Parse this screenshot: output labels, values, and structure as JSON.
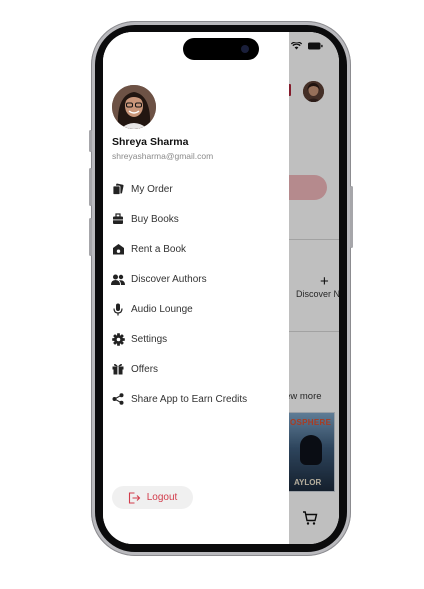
{
  "user": {
    "name": "Shreya Sharma",
    "email": "shreyasharma@gmail.com"
  },
  "menu": {
    "items": [
      {
        "label": "My Order",
        "icon": "orders-icon"
      },
      {
        "label": "Buy Books",
        "icon": "briefcase-icon"
      },
      {
        "label": "Rent a Book",
        "icon": "rent-cash-icon"
      },
      {
        "label": "Discover Authors",
        "icon": "people-icon"
      },
      {
        "label": "Audio Lounge",
        "icon": "microphone-icon"
      },
      {
        "label": "Settings",
        "icon": "gear-icon"
      },
      {
        "label": "Offers",
        "icon": "gift-icon"
      },
      {
        "label": "Share App to Earn Credits",
        "icon": "share-icon"
      }
    ]
  },
  "logout": {
    "label": "Logout"
  },
  "background": {
    "discover_text": "Discover N",
    "view_more": "iew more",
    "book_title": "OSPHERE",
    "book_author": "AYLOR"
  },
  "colors": {
    "accent": "#d23c4b",
    "pill": "#f2b9bd"
  }
}
